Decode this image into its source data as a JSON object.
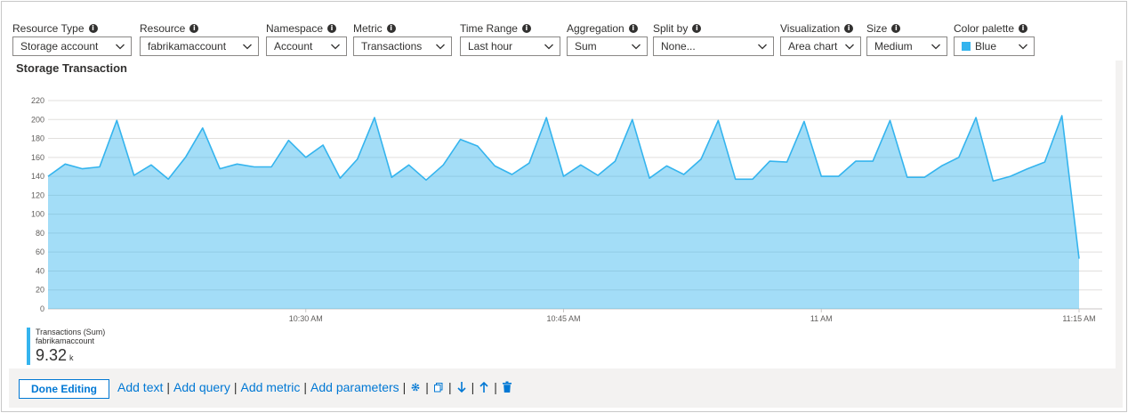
{
  "params": [
    {
      "label": "Resource Type",
      "value": "Storage account"
    },
    {
      "label": "Resource",
      "value": "fabrikamaccount"
    },
    {
      "label": "Namespace",
      "value": "Account"
    },
    {
      "label": "Metric",
      "value": "Transactions"
    },
    {
      "label": "Time Range",
      "value": "Last hour"
    },
    {
      "label": "Aggregation",
      "value": "Sum"
    },
    {
      "label": "Split by",
      "value": "None..."
    },
    {
      "label": "Visualization",
      "value": "Area chart"
    },
    {
      "label": "Size",
      "value": "Medium"
    },
    {
      "label": "Color palette",
      "value": "Blue"
    }
  ],
  "chart_title": "Storage Transaction",
  "chart_data": {
    "type": "area",
    "title": "Storage Transaction",
    "ylim": [
      0,
      220
    ],
    "y_ticks": [
      0,
      20,
      40,
      60,
      80,
      100,
      120,
      140,
      160,
      180,
      200,
      220
    ],
    "x_ticks": [
      "10:30 AM",
      "10:45 AM",
      "11 AM",
      "11:15 AM"
    ],
    "x_tick_positions_minutes": [
      15,
      30,
      45,
      60
    ],
    "x_start_minute": 0,
    "x_end_minute": 60,
    "series": [
      {
        "name": "Transactions (Sum)",
        "color": "#34b4ee",
        "values": [
          140,
          153,
          148,
          150,
          199,
          141,
          152,
          137,
          160,
          191,
          148,
          153,
          150,
          150,
          178,
          160,
          173,
          138,
          158,
          202,
          139,
          152,
          136,
          152,
          179,
          172,
          151,
          142,
          154,
          202,
          140,
          152,
          141,
          156,
          200,
          138,
          151,
          142,
          158,
          199,
          137,
          137,
          156,
          155,
          198,
          140,
          140,
          156,
          156,
          199,
          139,
          139,
          151,
          160,
          202,
          135,
          140,
          148,
          155,
          204,
          53
        ]
      }
    ]
  },
  "legend": {
    "line1": "Transactions (Sum)",
    "line2": "fabrikamaccount",
    "value": "9.32",
    "unit": "k"
  },
  "footer": {
    "done_label": "Done Editing",
    "add_text": "Add text",
    "add_query": "Add query",
    "add_metric": "Add metric",
    "add_parameters": "Add parameters",
    "sep": "|"
  },
  "icons": {
    "settings": "gear-icon",
    "copy": "copy-icon",
    "move_down": "arrow-down-icon",
    "move_up": "arrow-up-icon",
    "delete": "trash-icon"
  }
}
